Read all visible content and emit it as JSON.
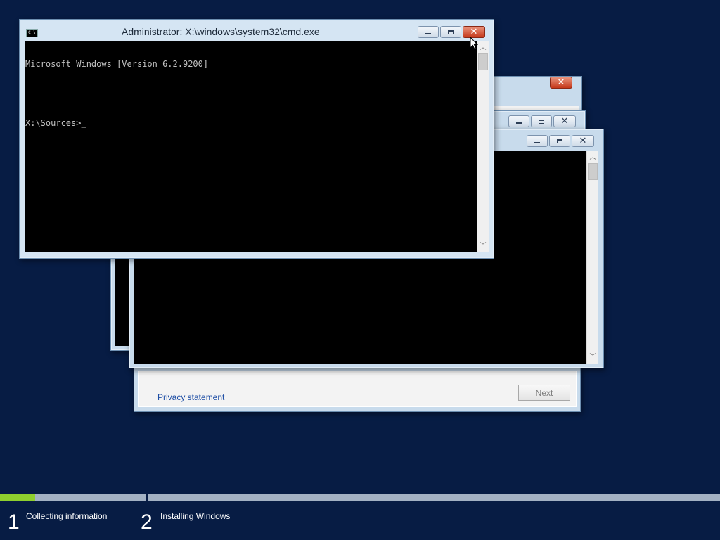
{
  "cmd_window": {
    "title": "Administrator: X:\\windows\\system32\\cmd.exe",
    "lines": [
      "Microsoft Windows [Version 6.2.9200]",
      "",
      "X:\\Sources>_"
    ]
  },
  "setup_dialog": {
    "privacy_link": "Privacy statement",
    "next_label": "Next"
  },
  "progress": {
    "steps": [
      {
        "number": "1",
        "label": "Collecting information"
      },
      {
        "number": "2",
        "label": "Installing Windows"
      }
    ],
    "step1_fraction": 0.24,
    "step2_fraction": 0.0
  },
  "icons": [
    "cmd-icon",
    "minimize-icon",
    "maximize-icon",
    "close-icon",
    "mouse-pointer-icon",
    "scroll-up-icon",
    "scroll-down-icon"
  ],
  "colors": {
    "desktop": "#071c44",
    "progress_fill": "#8fcf2e",
    "close_button": "#c5391b"
  }
}
